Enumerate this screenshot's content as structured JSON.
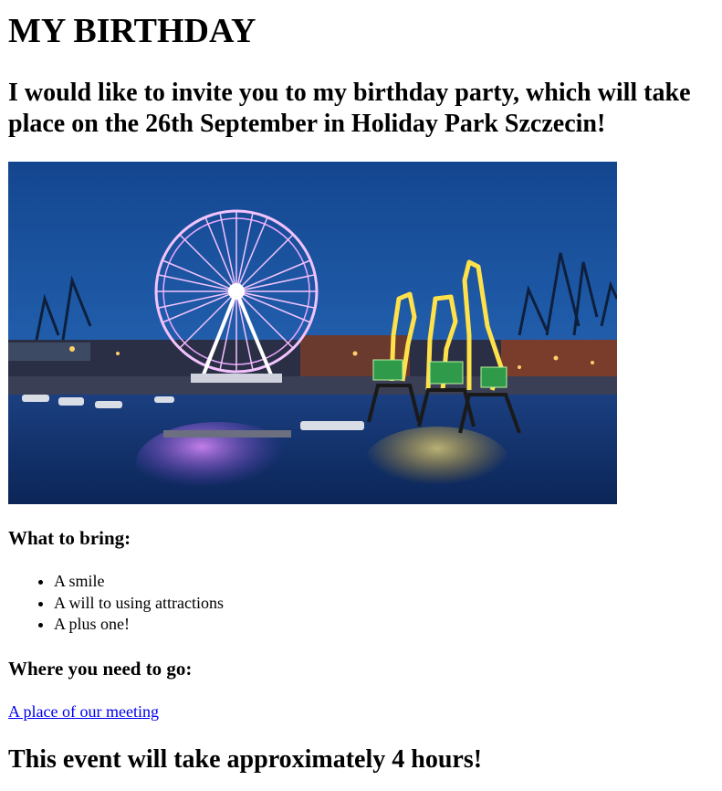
{
  "title": "MY BIRTHDAY",
  "invitation": "I would like to invite you to my birthday party, which will take place on the 26th September in Holiday Park Szczecin!",
  "photo": {
    "alt": "Szczecin waterfront at dusk with illuminated ferris wheel and cranes",
    "colors": {
      "sky": "#1f5ba8",
      "water": "#0d2f6a",
      "wheel_light": "#f0b6ff",
      "crane_light": "#ffe14a"
    }
  },
  "bring": {
    "heading": "What to bring:",
    "items": [
      "A smile",
      "A will to using attractions",
      "A plus one!"
    ]
  },
  "where": {
    "heading": "Where you need to go:",
    "link_text": "A place of our meeting"
  },
  "duration": "This event will take approximately 4 hours!",
  "colors": {
    "link": "#0000ee",
    "text": "#000000",
    "background": "#ffffff"
  }
}
